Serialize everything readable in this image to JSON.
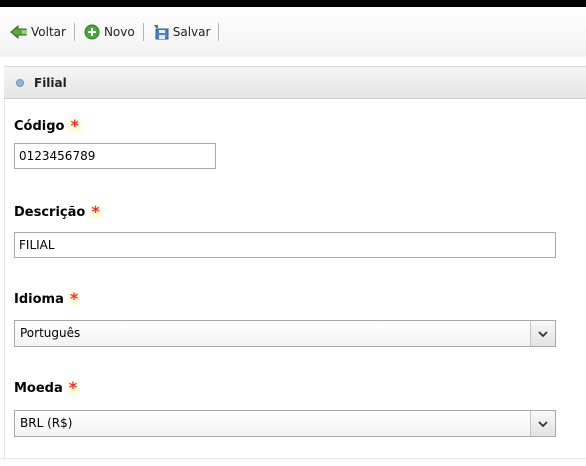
{
  "toolbar": {
    "back_label": "Voltar",
    "new_label": "Novo",
    "save_label": "Salvar"
  },
  "panel": {
    "title": "Filial"
  },
  "form": {
    "required_marker": "*",
    "codigo": {
      "label": "Código",
      "value": "0123456789"
    },
    "descricao": {
      "label": "Descrição",
      "value": "FILIAL"
    },
    "idioma": {
      "label": "Idioma",
      "value": "Português"
    },
    "moeda": {
      "label": "Moeda",
      "value": "BRL (R$)"
    }
  },
  "colors": {
    "required": "#ff2a2a",
    "required_bg": "#ffffdd",
    "header_bullet": "#8cb6d8"
  },
  "icons": {
    "back": "back-arrow-icon",
    "new": "add-circle-icon",
    "save": "save-disk-icon",
    "dropdown": "chevron-down-icon",
    "header_bullet": "bullet-icon"
  }
}
